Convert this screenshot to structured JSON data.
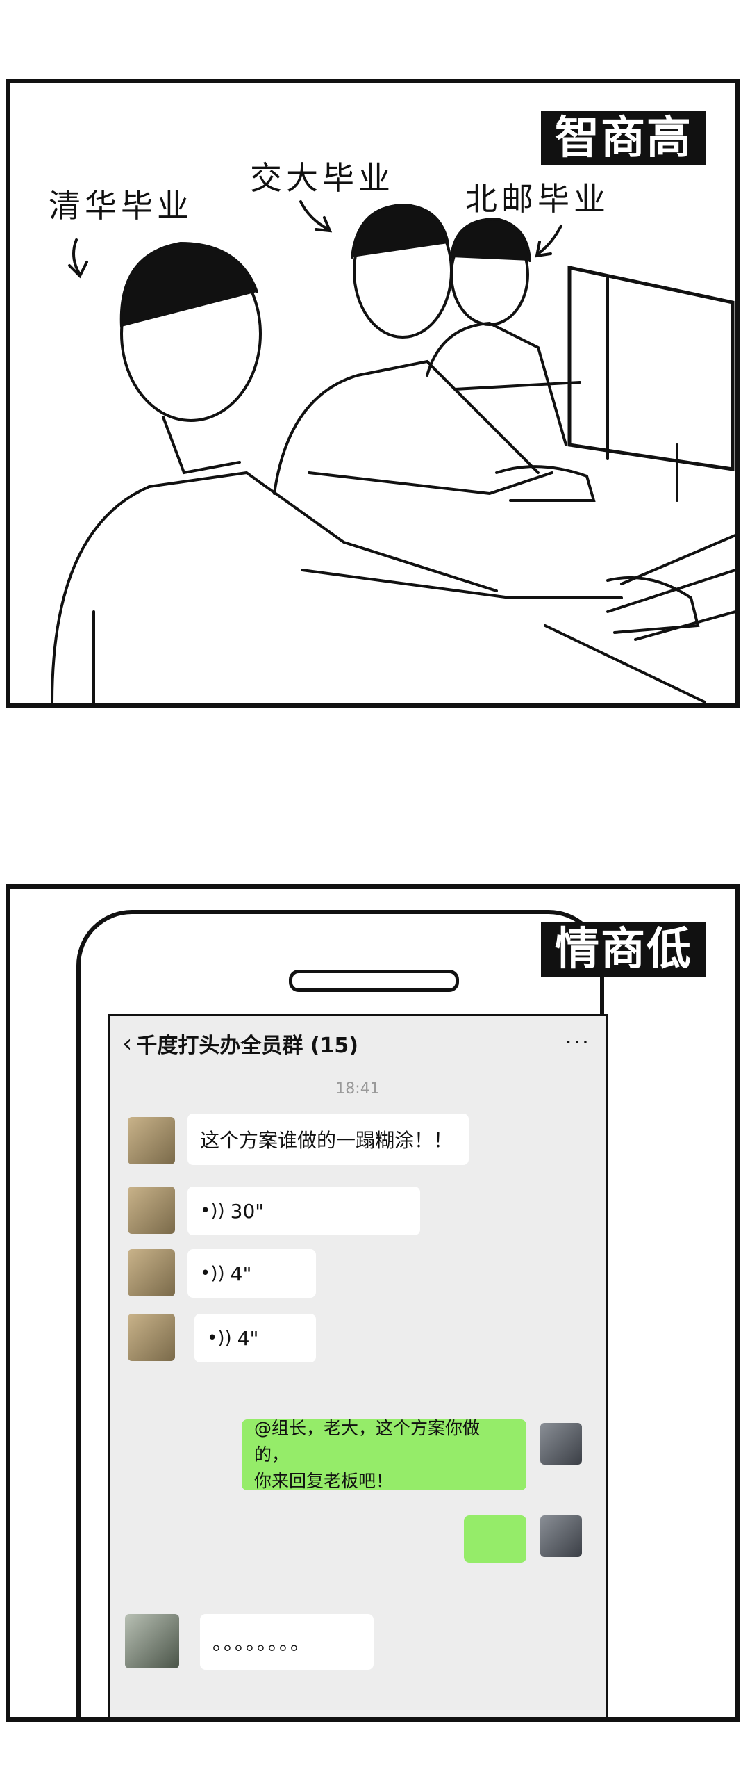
{
  "panel1": {
    "tag": "智商高",
    "labels": [
      "清华毕业",
      "交大毕业",
      "北邮毕业"
    ]
  },
  "panel2": {
    "tag": "情商低",
    "chat": {
      "title": "千度打头办全员群 (15)",
      "time": "18:41",
      "messages": [
        {
          "side": "left",
          "text": "这个方案谁做的一蹋糊涂！！"
        },
        {
          "side": "left",
          "voice": "30\""
        },
        {
          "side": "left",
          "voice": "4\""
        },
        {
          "side": "left",
          "voice": "4\""
        },
        {
          "side": "right",
          "line1": "@组长，老大，这个方案你做的，",
          "line2": "你来回复老板吧！"
        },
        {
          "side": "right",
          "text": ""
        },
        {
          "side": "left",
          "text": "。。。。。。。。"
        }
      ]
    }
  }
}
